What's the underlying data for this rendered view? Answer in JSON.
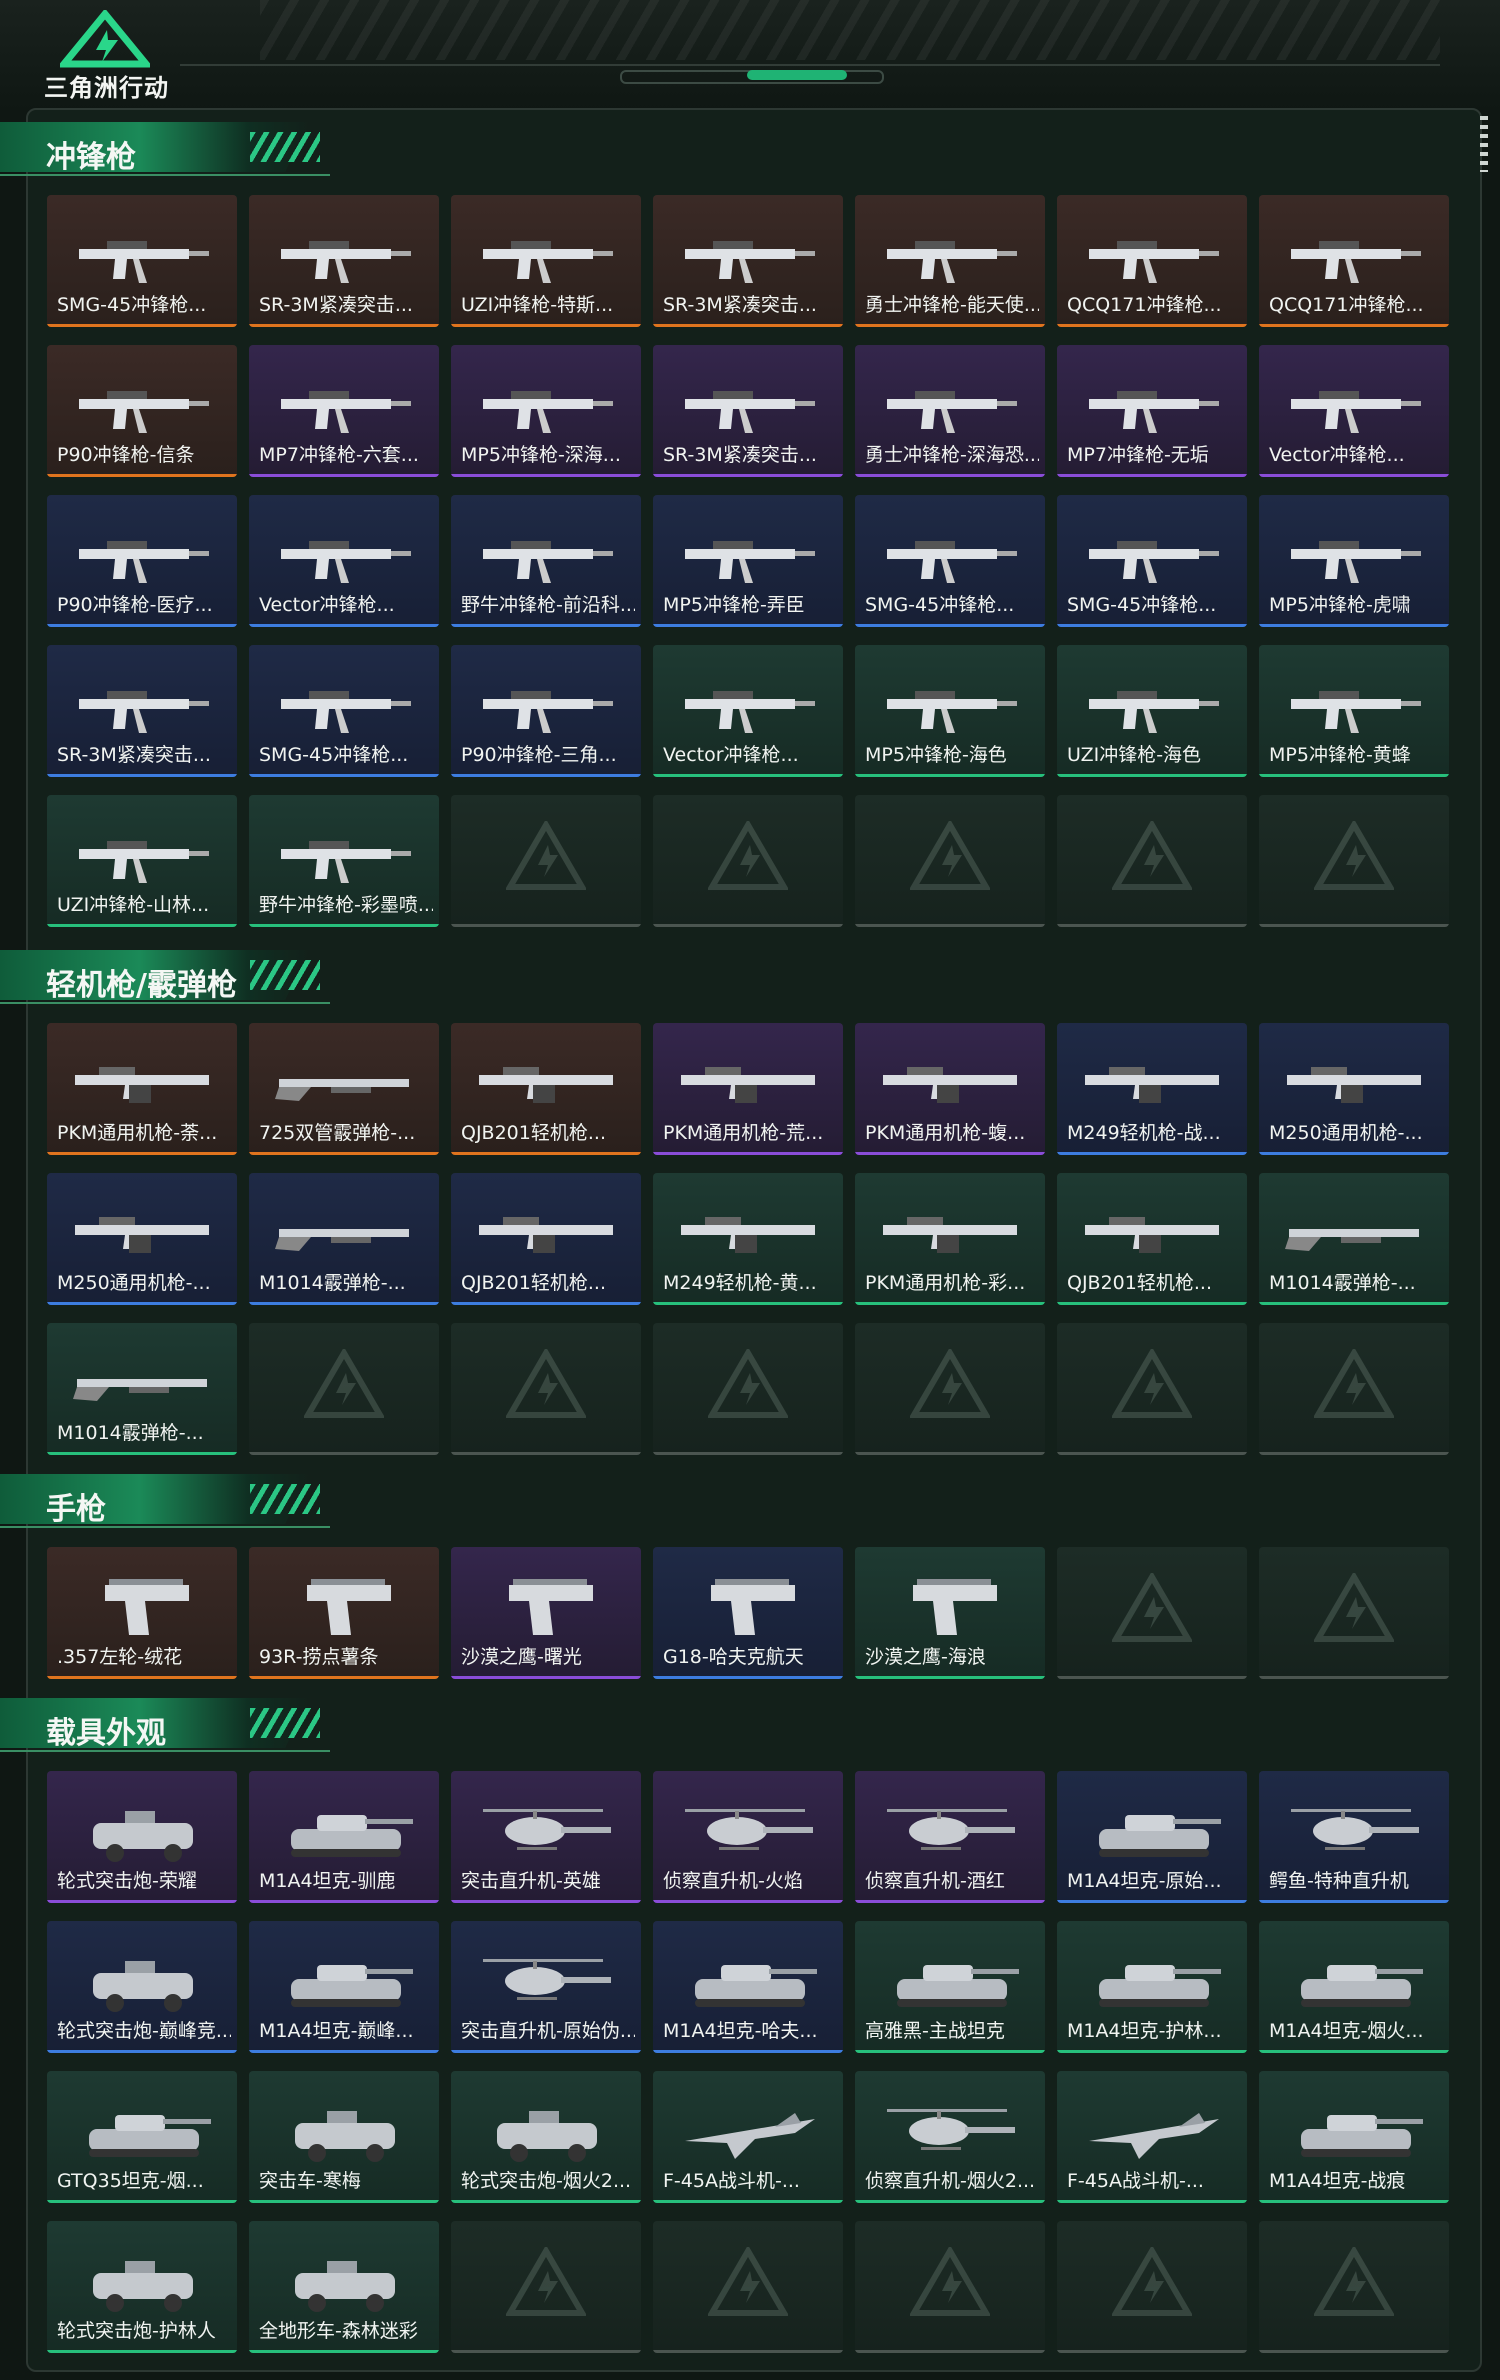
{
  "header": {
    "brand_name": "三角洲行动"
  },
  "colors": {
    "orange": "#e0741e",
    "purple": "#8a4dd8",
    "blue": "#3d7de0",
    "green": "#27c07c",
    "accent": "#1fb374"
  },
  "sections": [
    {
      "title": "冲锋枪",
      "rows": 5,
      "items": [
        {
          "label": "SMG-45冲锋枪...",
          "rarity": "orange",
          "icon": "smg"
        },
        {
          "label": "SR-3M紧凑突击...",
          "rarity": "orange",
          "icon": "smg"
        },
        {
          "label": "UZI冲锋枪-特斯...",
          "rarity": "orange",
          "icon": "smg"
        },
        {
          "label": "SR-3M紧凑突击...",
          "rarity": "orange",
          "icon": "smg"
        },
        {
          "label": "勇士冲锋枪-能天使...",
          "rarity": "orange",
          "icon": "smg"
        },
        {
          "label": "QCQ171冲锋枪...",
          "rarity": "orange",
          "icon": "smg"
        },
        {
          "label": "QCQ171冲锋枪...",
          "rarity": "orange",
          "icon": "smg"
        },
        {
          "label": "P90冲锋枪-信条",
          "rarity": "orange",
          "icon": "smg"
        },
        {
          "label": "MP7冲锋枪-六套...",
          "rarity": "purple",
          "icon": "smg"
        },
        {
          "label": "MP5冲锋枪-深海...",
          "rarity": "purple",
          "icon": "smg"
        },
        {
          "label": "SR-3M紧凑突击...",
          "rarity": "purple",
          "icon": "smg"
        },
        {
          "label": "勇士冲锋枪-深海恐...",
          "rarity": "purple",
          "icon": "smg"
        },
        {
          "label": "MP7冲锋枪-无垢",
          "rarity": "purple",
          "icon": "smg"
        },
        {
          "label": "Vector冲锋枪...",
          "rarity": "purple",
          "icon": "smg"
        },
        {
          "label": "P90冲锋枪-医疗...",
          "rarity": "blue",
          "icon": "smg"
        },
        {
          "label": "Vector冲锋枪...",
          "rarity": "blue",
          "icon": "smg"
        },
        {
          "label": "野牛冲锋枪-前沿科...",
          "rarity": "blue",
          "icon": "smg"
        },
        {
          "label": "MP5冲锋枪-弄臣",
          "rarity": "blue",
          "icon": "smg"
        },
        {
          "label": "SMG-45冲锋枪...",
          "rarity": "blue",
          "icon": "smg"
        },
        {
          "label": "SMG-45冲锋枪...",
          "rarity": "blue",
          "icon": "smg"
        },
        {
          "label": "MP5冲锋枪-虎啸",
          "rarity": "blue",
          "icon": "smg"
        },
        {
          "label": "SR-3M紧凑突击...",
          "rarity": "blue",
          "icon": "smg"
        },
        {
          "label": "SMG-45冲锋枪...",
          "rarity": "blue",
          "icon": "smg"
        },
        {
          "label": "P90冲锋枪-三角...",
          "rarity": "blue",
          "icon": "smg"
        },
        {
          "label": "Vector冲锋枪...",
          "rarity": "green",
          "icon": "smg"
        },
        {
          "label": "MP5冲锋枪-海色",
          "rarity": "green",
          "icon": "smg"
        },
        {
          "label": "UZI冲锋枪-海色",
          "rarity": "green",
          "icon": "smg"
        },
        {
          "label": "MP5冲锋枪-黄蜂",
          "rarity": "green",
          "icon": "smg"
        },
        {
          "label": "UZI冲锋枪-山林...",
          "rarity": "green",
          "icon": "smg"
        },
        {
          "label": "野牛冲锋枪-彩墨喷...",
          "rarity": "green",
          "icon": "smg"
        }
      ]
    },
    {
      "title": "轻机枪/霰弹枪",
      "rows": 3,
      "items": [
        {
          "label": "PKM通用机枪-荼...",
          "rarity": "orange",
          "icon": "lmg"
        },
        {
          "label": "725双管霰弹枪-...",
          "rarity": "orange",
          "icon": "shotgun"
        },
        {
          "label": "QJB201轻机枪...",
          "rarity": "orange",
          "icon": "lmg"
        },
        {
          "label": "PKM通用机枪-荒...",
          "rarity": "purple",
          "icon": "lmg"
        },
        {
          "label": "PKM通用机枪-蝮...",
          "rarity": "purple",
          "icon": "lmg"
        },
        {
          "label": "M249轻机枪-战...",
          "rarity": "blue",
          "icon": "lmg"
        },
        {
          "label": "M250通用机枪-...",
          "rarity": "blue",
          "icon": "lmg"
        },
        {
          "label": "M250通用机枪-...",
          "rarity": "blue",
          "icon": "lmg"
        },
        {
          "label": "M1014霰弹枪-...",
          "rarity": "blue",
          "icon": "shotgun"
        },
        {
          "label": "QJB201轻机枪...",
          "rarity": "blue",
          "icon": "lmg"
        },
        {
          "label": "M249轻机枪-黄...",
          "rarity": "green",
          "icon": "lmg"
        },
        {
          "label": "PKM通用机枪-彩...",
          "rarity": "green",
          "icon": "lmg"
        },
        {
          "label": "QJB201轻机枪...",
          "rarity": "green",
          "icon": "lmg"
        },
        {
          "label": "M1014霰弹枪-...",
          "rarity": "green",
          "icon": "shotgun"
        },
        {
          "label": "M1014霰弹枪-...",
          "rarity": "green",
          "icon": "shotgun"
        }
      ]
    },
    {
      "title": "手枪",
      "rows": 1,
      "items": [
        {
          "label": ".357左轮-绒花",
          "rarity": "orange",
          "icon": "pistol"
        },
        {
          "label": "93R-捞点薯条",
          "rarity": "orange",
          "icon": "pistol"
        },
        {
          "label": "沙漠之鹰-曙光",
          "rarity": "purple",
          "icon": "pistol"
        },
        {
          "label": "G18-哈夫克航天",
          "rarity": "blue",
          "icon": "pistol"
        },
        {
          "label": "沙漠之鹰-海浪",
          "rarity": "green",
          "icon": "pistol"
        }
      ]
    },
    {
      "title": "载具外观",
      "rows": 4,
      "items": [
        {
          "label": "轮式突击炮-荣耀",
          "rarity": "purple",
          "icon": "vehicle"
        },
        {
          "label": "M1A4坦克-驯鹿",
          "rarity": "purple",
          "icon": "tank"
        },
        {
          "label": "突击直升机-英雄",
          "rarity": "purple",
          "icon": "helicopter"
        },
        {
          "label": "侦察直升机-火焰",
          "rarity": "purple",
          "icon": "helicopter"
        },
        {
          "label": "侦察直升机-酒红",
          "rarity": "purple",
          "icon": "helicopter"
        },
        {
          "label": "M1A4坦克-原始...",
          "rarity": "blue",
          "icon": "tank"
        },
        {
          "label": "鳄鱼-特种直升机",
          "rarity": "blue",
          "icon": "helicopter"
        },
        {
          "label": "轮式突击炮-巅峰竞...",
          "rarity": "blue",
          "icon": "vehicle"
        },
        {
          "label": "M1A4坦克-巅峰...",
          "rarity": "blue",
          "icon": "tank"
        },
        {
          "label": "突击直升机-原始伪...",
          "rarity": "blue",
          "icon": "helicopter"
        },
        {
          "label": "M1A4坦克-哈夫...",
          "rarity": "blue",
          "icon": "tank"
        },
        {
          "label": "高雅黑-主战坦克",
          "rarity": "green",
          "icon": "tank"
        },
        {
          "label": "M1A4坦克-护林...",
          "rarity": "green",
          "icon": "tank"
        },
        {
          "label": "M1A4坦克-烟火...",
          "rarity": "green",
          "icon": "tank"
        },
        {
          "label": "GTQ35坦克-烟...",
          "rarity": "green",
          "icon": "tank"
        },
        {
          "label": "突击车-寒梅",
          "rarity": "green",
          "icon": "vehicle"
        },
        {
          "label": "轮式突击炮-烟火2...",
          "rarity": "green",
          "icon": "vehicle"
        },
        {
          "label": "F-45A战斗机-...",
          "rarity": "green",
          "icon": "jet"
        },
        {
          "label": "侦察直升机-烟火2...",
          "rarity": "green",
          "icon": "helicopter"
        },
        {
          "label": "F-45A战斗机-...",
          "rarity": "green",
          "icon": "jet"
        },
        {
          "label": "M1A4坦克-战痕",
          "rarity": "green",
          "icon": "tank"
        },
        {
          "label": "轮式突击炮-护林人",
          "rarity": "green",
          "icon": "vehicle"
        },
        {
          "label": "全地形车-森林迷彩",
          "rarity": "green",
          "icon": "vehicle"
        }
      ]
    }
  ]
}
